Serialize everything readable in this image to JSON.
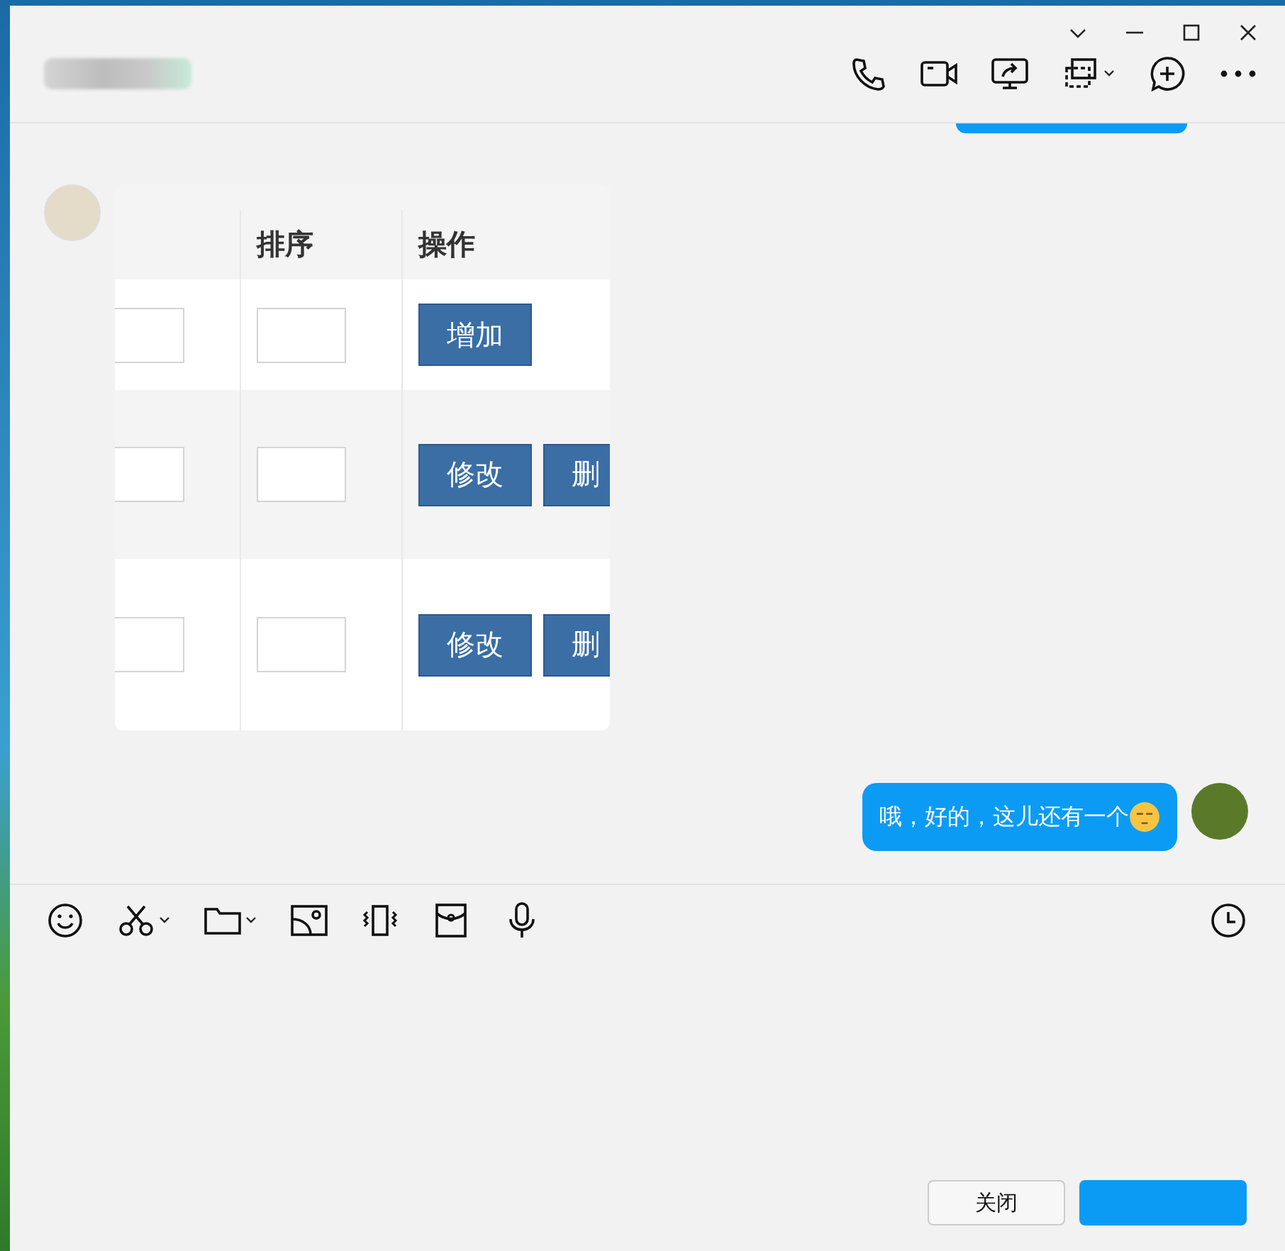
{
  "chat": {
    "image_table": {
      "columns": [
        "",
        "排序",
        "操作"
      ],
      "rows": [
        {
          "actions": [
            "增加"
          ]
        },
        {
          "actions": [
            "修改",
            "删"
          ]
        },
        {
          "actions": [
            "修改",
            "删"
          ]
        }
      ]
    },
    "messages": [
      {
        "kind": "image"
      },
      {
        "kind": "text",
        "text": "哦，好的，这儿还有一个",
        "emoji": true
      }
    ]
  },
  "buttons": [
    {
      "label": "关闭",
      "kind": "secondary"
    },
    {
      "kind": "primary"
    }
  ]
}
